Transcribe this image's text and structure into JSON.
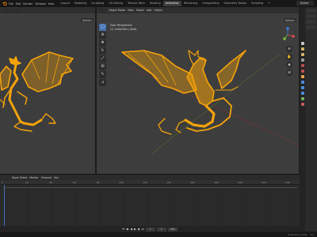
{
  "app": {
    "logo_icon": "blender-logo-icon"
  },
  "menu": [
    "File",
    "Edit",
    "Render",
    "Window",
    "Help"
  ],
  "tabs": [
    {
      "label": "Layout",
      "active": false
    },
    {
      "label": "Modeling",
      "active": false
    },
    {
      "label": "Sculpting",
      "active": false
    },
    {
      "label": "UV Editing",
      "active": false
    },
    {
      "label": "Texture Paint",
      "active": false
    },
    {
      "label": "Shading",
      "active": false
    },
    {
      "label": "Animation",
      "active": true
    },
    {
      "label": "Rendering",
      "active": false
    },
    {
      "label": "Compositing",
      "active": false
    },
    {
      "label": "Geometry Nodes",
      "active": false
    },
    {
      "label": "Scripting",
      "active": false
    },
    {
      "label": "+",
      "active": false
    }
  ],
  "scene": {
    "label": "Scene"
  },
  "viewport_right": {
    "mode": "Object Mode",
    "menus": [
      "View",
      "Select",
      "Add",
      "Object"
    ],
    "info_line1": "User Perspective",
    "info_line2": "(1) Collection | body",
    "options": "Options"
  },
  "viewport_left": {
    "options": "Options"
  },
  "timeline": {
    "menus": [
      "Dope Sheet",
      "Marker",
      "Channel",
      "Key"
    ],
    "ticks": [
      "0",
      "20",
      "40",
      "60",
      "80",
      "100",
      "120",
      "140",
      "160",
      "180",
      "200",
      "220",
      "240"
    ]
  },
  "playback": {
    "current_frame": "1",
    "start": "1",
    "end": "250"
  },
  "status": {
    "collection": "Collection | body",
    "version": "3.4"
  },
  "colors": {
    "accent": "#4772b3",
    "object": "#f5a30a",
    "viewport_bg": "#3d3d3d"
  }
}
